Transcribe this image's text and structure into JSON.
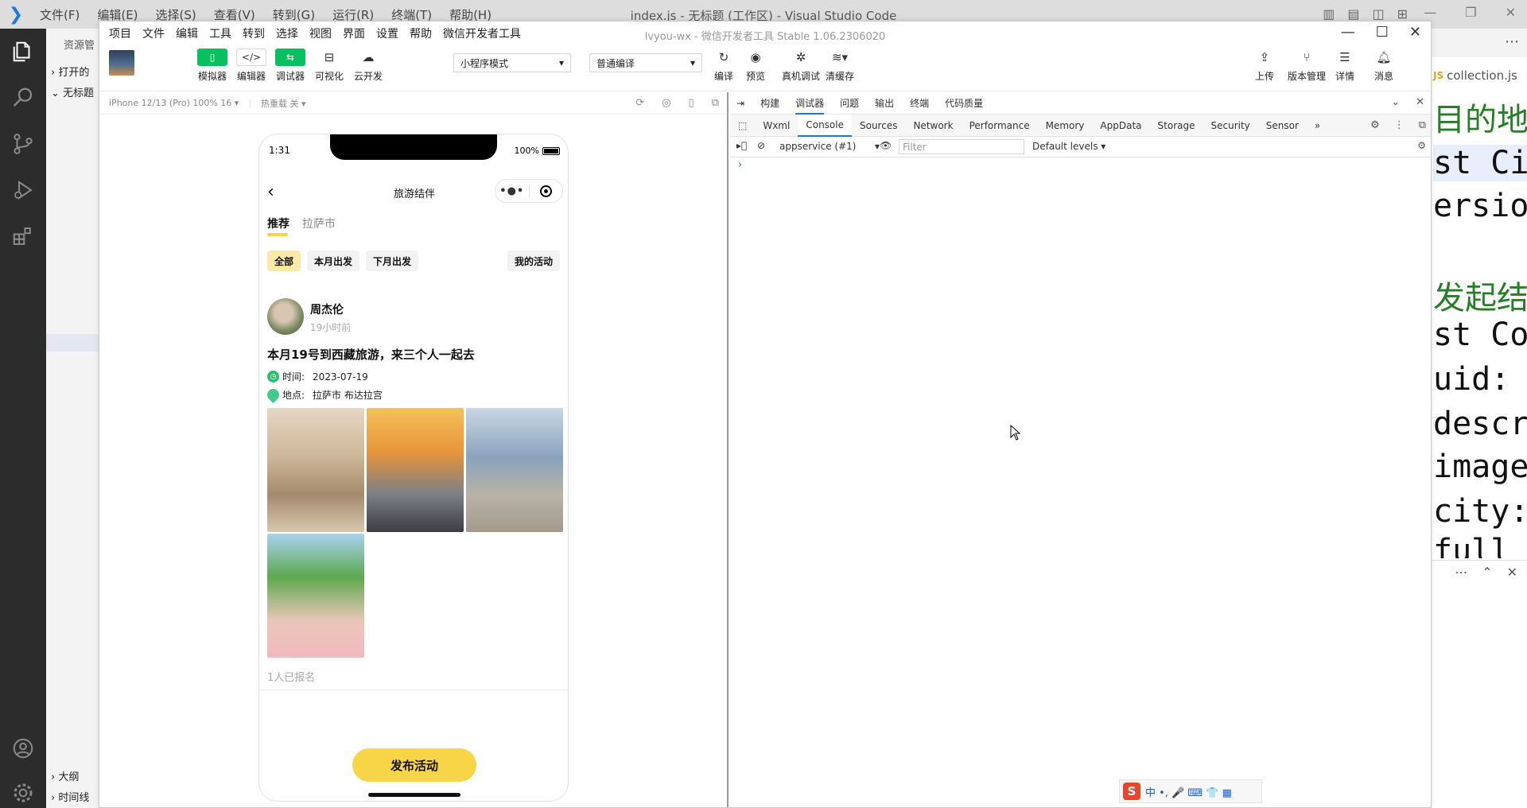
{
  "vscode": {
    "menu": [
      "文件(F)",
      "编辑(E)",
      "选择(S)",
      "查看(V)",
      "转到(G)",
      "运行(R)",
      "终端(T)",
      "帮助(H)"
    ],
    "window_title": "index.js - 无标题 (工作区) - Visual Studio Code",
    "sidebar": {
      "header": "资源管",
      "sections": [
        "打开的",
        "无标题"
      ],
      "bottom": [
        "大纲",
        "时间线"
      ]
    },
    "editor_tab": "collection.js",
    "code_fragments": [
      "目的地列",
      "st Cit",
      "ersio",
      "发起结伴",
      "st Com",
      "uid:",
      "descr",
      "image",
      "city:",
      "full"
    ]
  },
  "wx": {
    "menu": [
      "项目",
      "文件",
      "编辑",
      "工具",
      "转到",
      "选择",
      "视图",
      "界面",
      "设置",
      "帮助",
      "微信开发者工具"
    ],
    "title": "lvyou-wx - 微信开发者工具 Stable 1.06.2306020",
    "toolbar": {
      "simulator": "模拟器",
      "editor": "编辑器",
      "debugger": "调试器",
      "visual": "可视化",
      "cloud": "云开发",
      "mode_select": "小程序模式",
      "compile_select": "普通编译",
      "compile": "编译",
      "preview": "预览",
      "real_debug": "真机调试",
      "clear_cache": "清缓存",
      "upload": "上传",
      "version": "版本管理",
      "details": "详情",
      "messages": "消息"
    },
    "sim_bar": {
      "device": "iPhone 12/13 (Pro) 100% 16 ▾",
      "hotreload": "热重载 关 ▾"
    },
    "phone": {
      "time": "1:31",
      "battery": "100%",
      "nav_title": "旅游结伴",
      "tabs": [
        "推荐",
        "拉萨市"
      ],
      "filters": [
        "全部",
        "本月出发",
        "下月出发"
      ],
      "my_activity": "我的活动",
      "post": {
        "author": "周杰伦",
        "ago": "19小时前",
        "title": "本月19号到西藏旅游，来三个人一起去",
        "time_label": "时间:",
        "time_value": "2023-07-19",
        "place_label": "地点:",
        "place_value": "拉萨市 布达拉宫",
        "signed": "1人已报名"
      },
      "publish": "发布活动"
    },
    "devtools": {
      "top_tabs": [
        "构建",
        "调试器",
        "问题",
        "输出",
        "终端",
        "代码质量"
      ],
      "tabs": [
        "Wxml",
        "Console",
        "Sources",
        "Network",
        "Performance",
        "Memory",
        "AppData",
        "Storage",
        "Security",
        "Sensor"
      ],
      "context": "appservice (#1)",
      "filter_placeholder": "Filter",
      "levels": "Default levels ▾",
      "prompt": "›"
    }
  },
  "ime": {
    "logo": "S",
    "label": "中 •, 🎤 ⌨ 👕 ▦"
  }
}
